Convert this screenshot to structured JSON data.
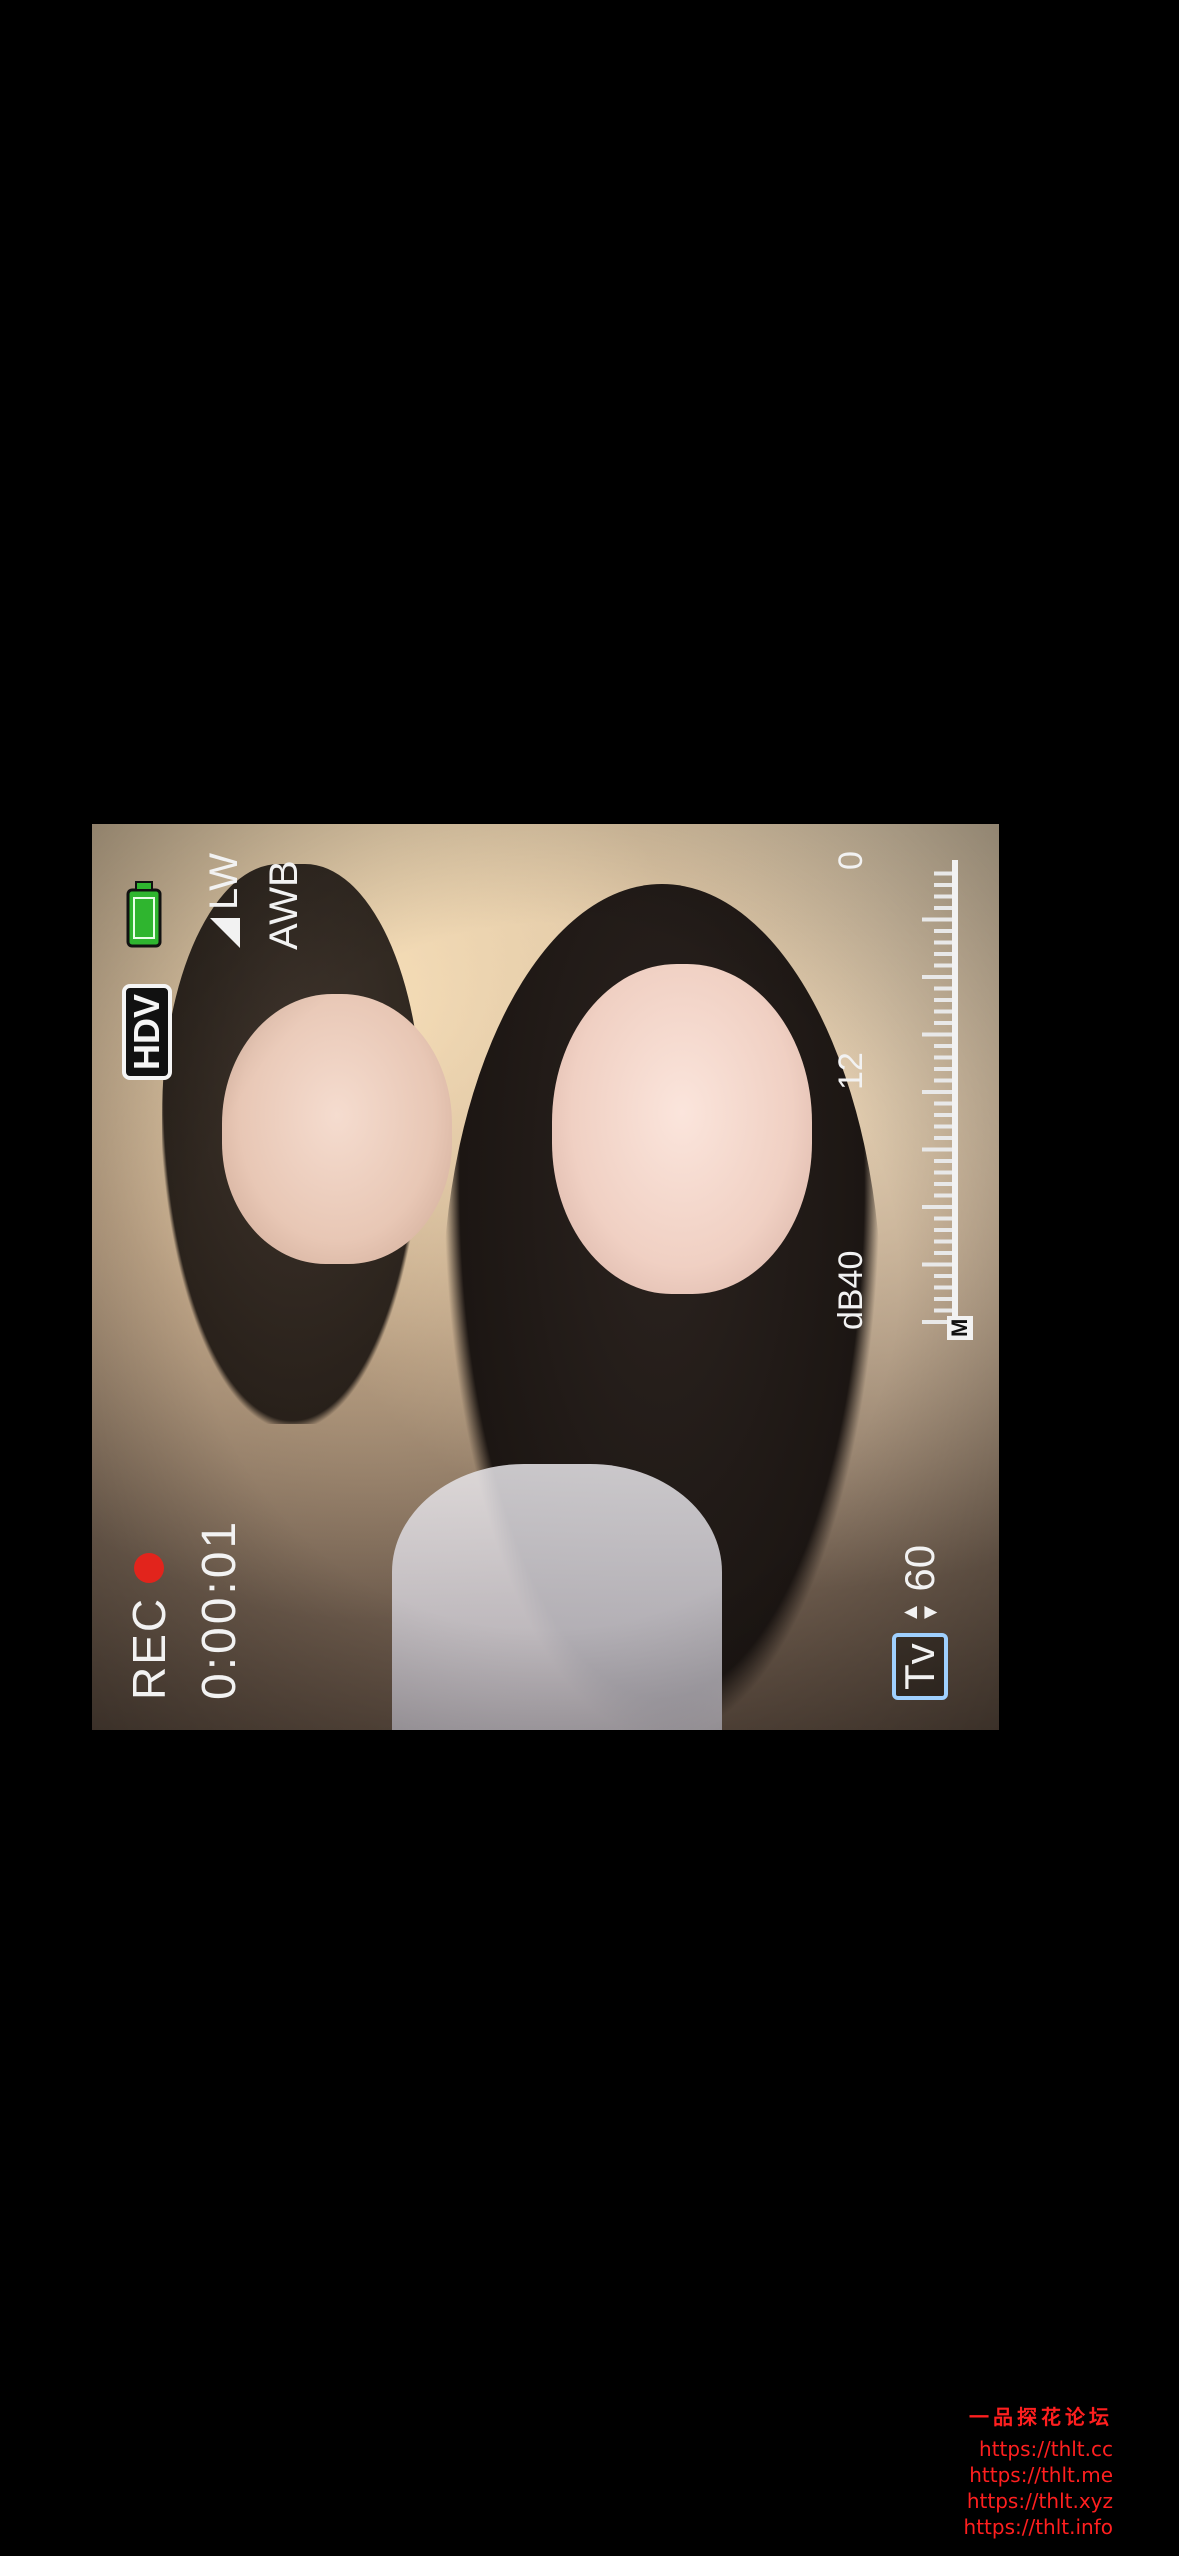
{
  "camcorder_hud": {
    "rec_label": "REC",
    "timecode": "0:00:01",
    "format_badge": "HDV",
    "lens_label": "LW",
    "white_balance": "AWB",
    "mode_badge": "Tv",
    "shutter_value": "60",
    "audio_meter": {
      "db_label": "dB40",
      "mid_label": "12",
      "max_label": "0",
      "mode_marker": "M"
    },
    "colors": {
      "rec_dot": "#e2241c",
      "battery": "#2fb52f",
      "tv_border": "#9fd0ff"
    },
    "icons": [
      "rec-dot-icon",
      "battery-icon",
      "triangle-icon",
      "updown-arrows-icon"
    ]
  },
  "watermark": {
    "title": "一品探花论坛",
    "links": [
      "https://thlt.cc",
      "https://thlt.me",
      "https://thlt.xyz",
      "https://thlt.info"
    ]
  }
}
